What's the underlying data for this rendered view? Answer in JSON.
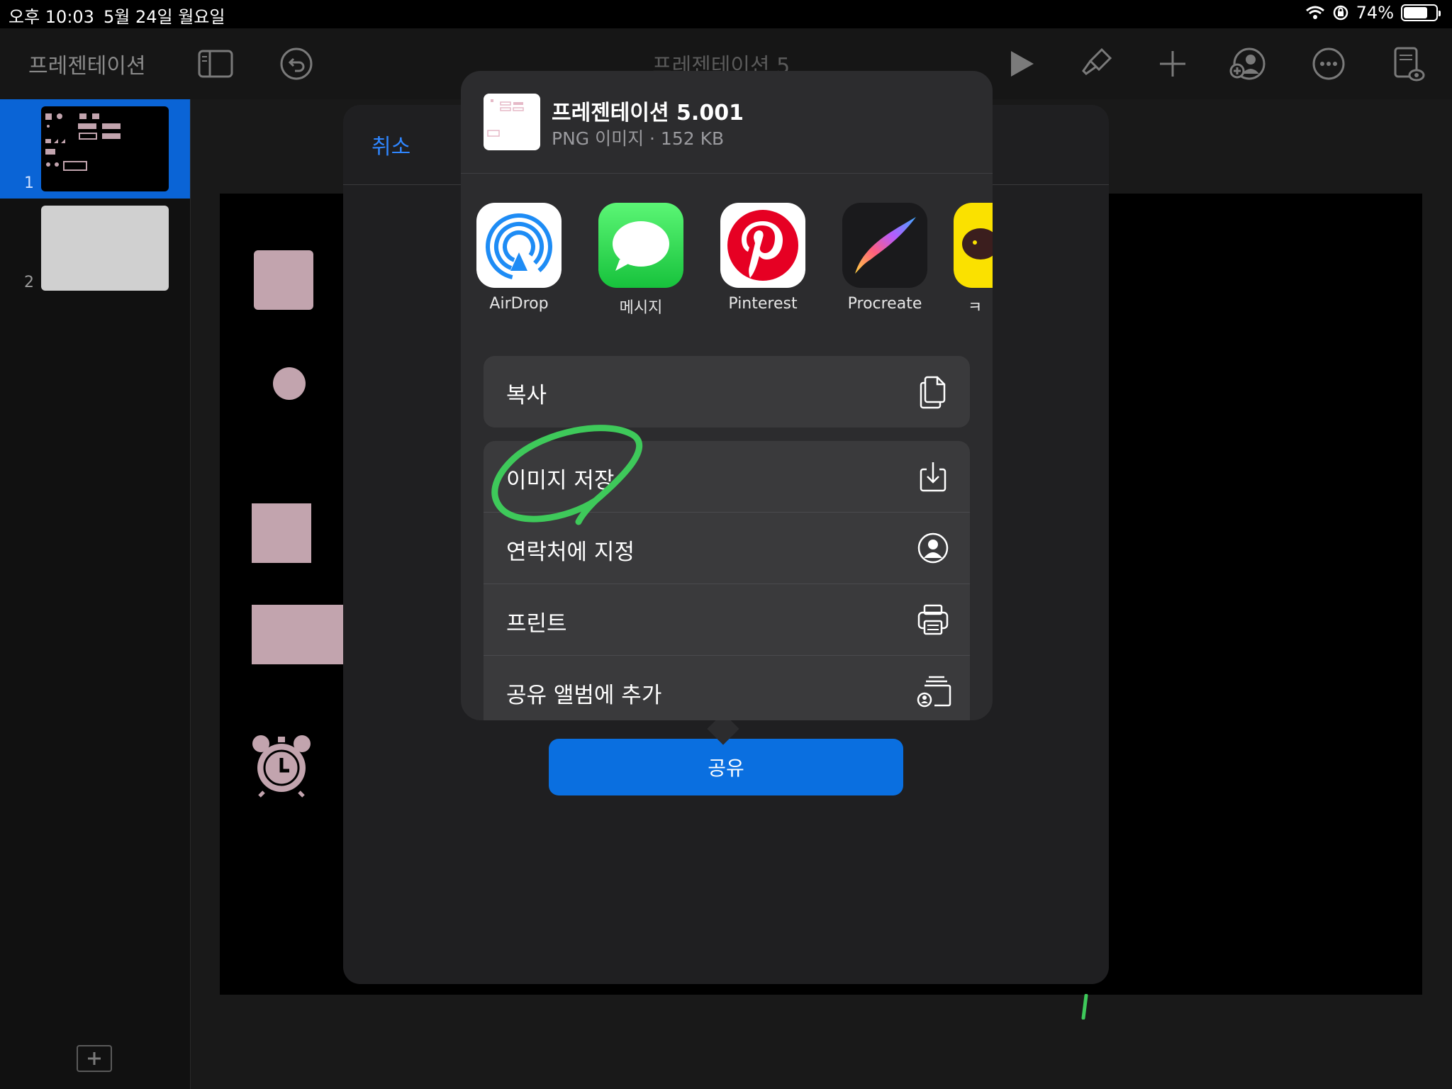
{
  "status_bar": {
    "time": "오후 10:03",
    "date": "5월 24일 월요일",
    "battery": "74%",
    "battery_level": 0.74
  },
  "toolbar": {
    "presentations_label": "프레젠테이션",
    "doc_title": "프레젠테이션 5"
  },
  "sidebar": {
    "slides": [
      {
        "number": "1",
        "selected": true
      },
      {
        "number": "2",
        "selected": false
      }
    ]
  },
  "dialog": {
    "cancel_label": "취소",
    "share_label": "공유"
  },
  "share_sheet": {
    "file_name": "프레젠테이션 5.001",
    "file_meta": "PNG 이미지 · 152 KB",
    "apps": [
      {
        "label": "AirDrop",
        "icon": "airdrop-icon"
      },
      {
        "label": "메시지",
        "icon": "messages-icon"
      },
      {
        "label": "Pinterest",
        "icon": "pinterest-icon"
      },
      {
        "label": "Procreate",
        "icon": "procreate-icon"
      },
      {
        "label": "ㅋ",
        "icon": "kakaotalk-icon"
      }
    ],
    "actions": [
      {
        "label": "복사",
        "icon": "copy-icon"
      },
      {
        "label": "이미지 저장",
        "icon": "save-image-icon"
      },
      {
        "label": "연락처에 지정",
        "icon": "contact-icon"
      },
      {
        "label": "프린트",
        "icon": "print-icon"
      },
      {
        "label": "공유 앨범에 추가",
        "icon": "shared-album-icon"
      }
    ]
  },
  "colors": {
    "accent": "#2f86ff",
    "share_button": "#0a6fe0",
    "selected_slide": "#0a64d6",
    "highlight_stroke": "#3ec95a",
    "shape_pink": "#c2a4ae"
  }
}
